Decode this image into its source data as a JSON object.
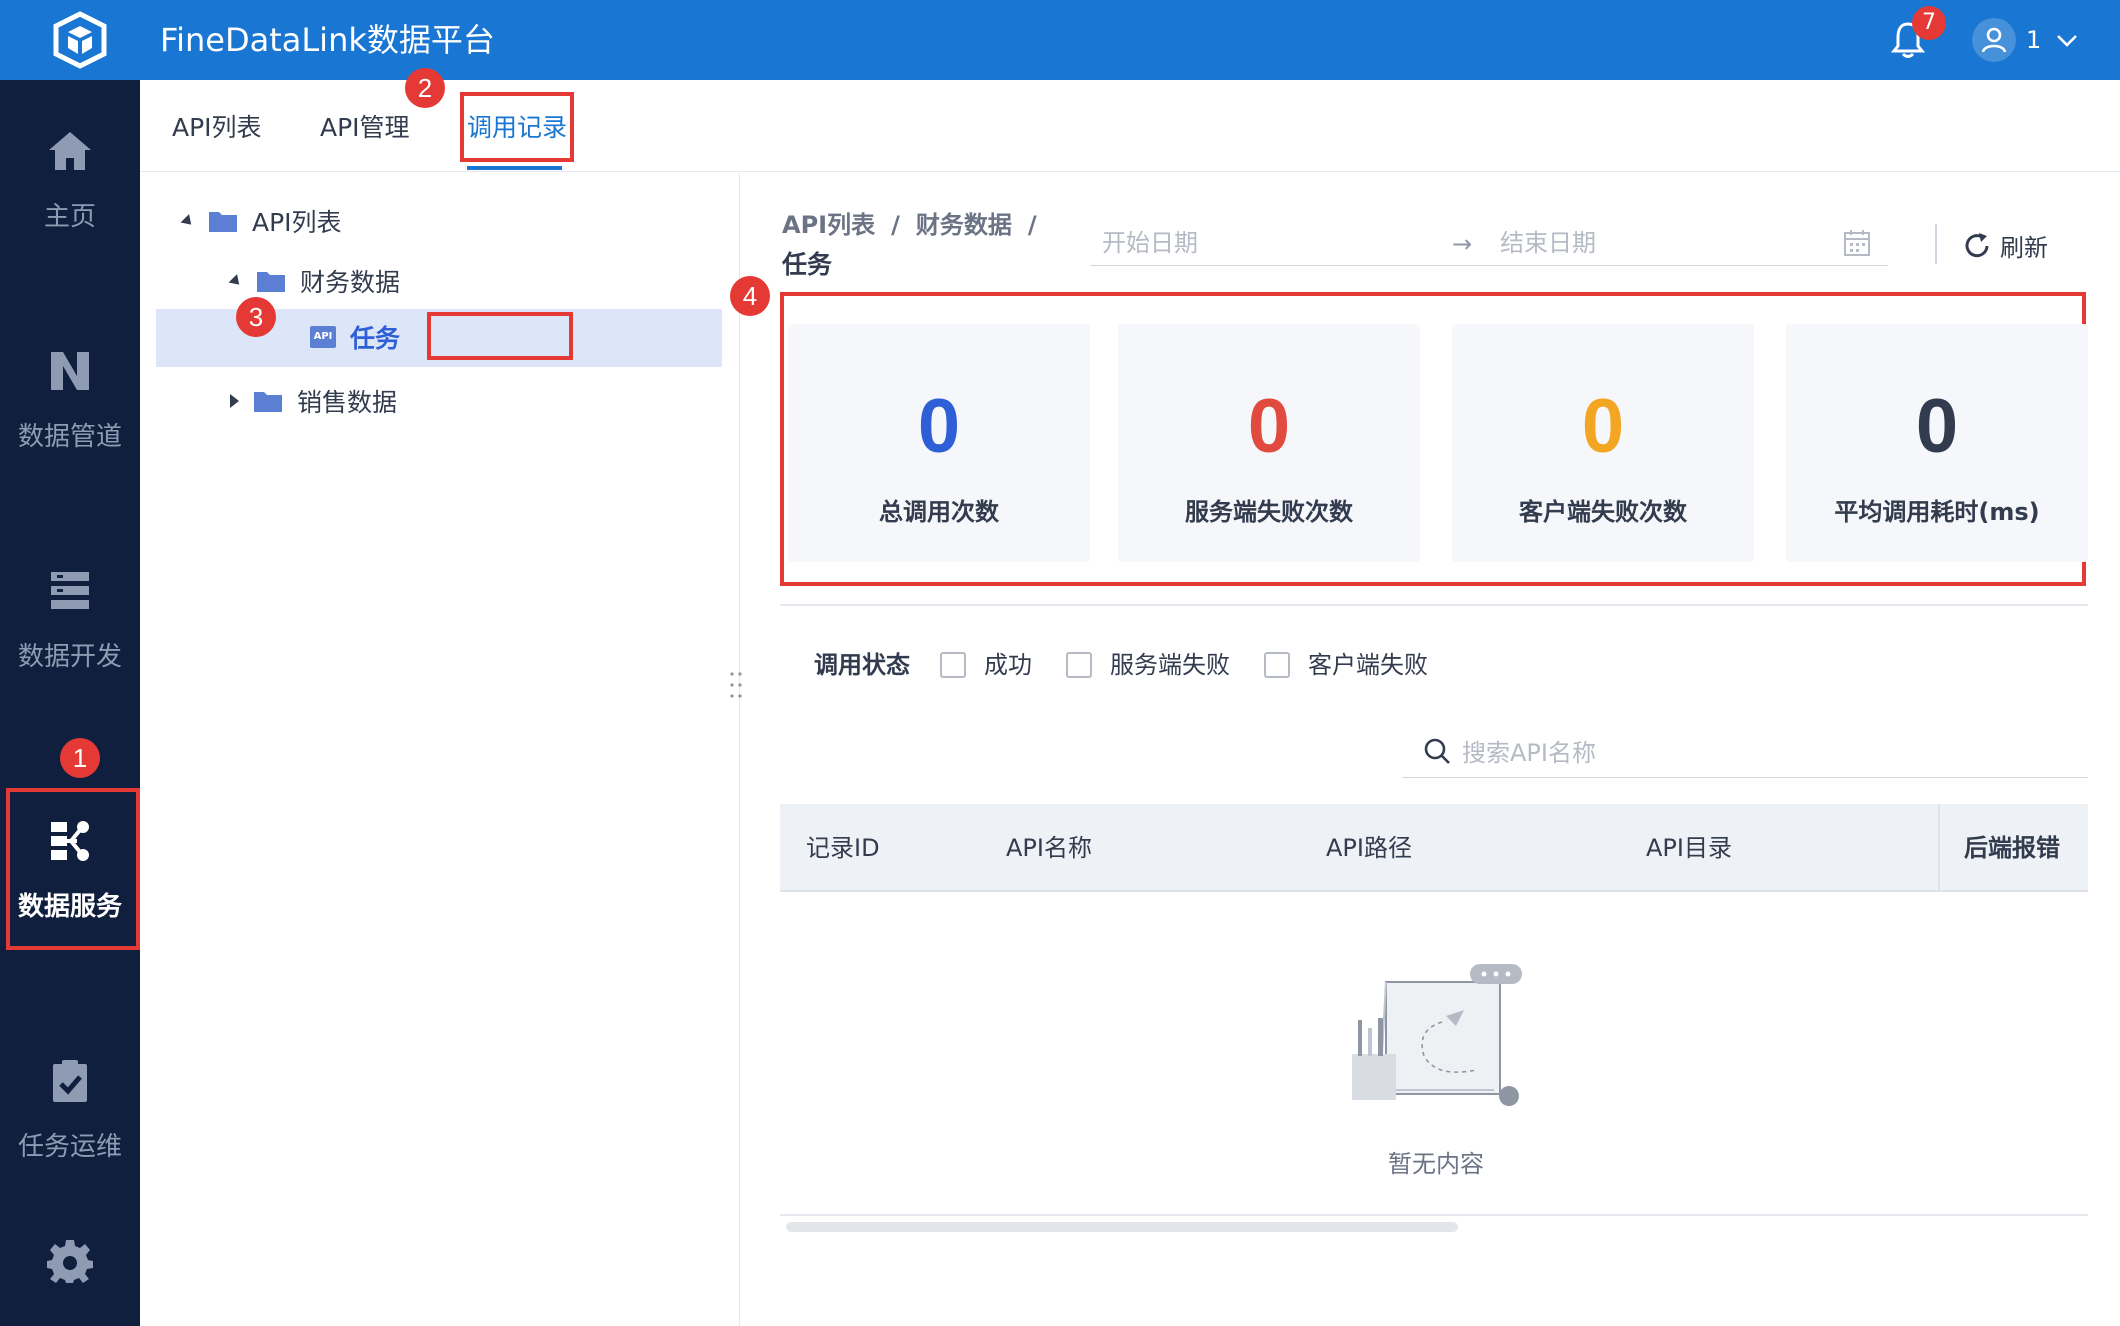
{
  "header": {
    "title": "FineDataLink数据平台",
    "notification_count": "7",
    "user_name": "1"
  },
  "sidebar": {
    "items": [
      {
        "label": "主页",
        "icon": "home-icon"
      },
      {
        "label": "数据管道",
        "icon": "pipeline-icon"
      },
      {
        "label": "数据开发",
        "icon": "dev-icon"
      },
      {
        "label": "数据服务",
        "icon": "data-service-icon",
        "active": true
      },
      {
        "label": "任务运维",
        "icon": "task-ops-icon"
      },
      {
        "label": "",
        "icon": "gear-icon"
      }
    ]
  },
  "tabs": [
    {
      "label": "API列表"
    },
    {
      "label": "API管理"
    },
    {
      "label": "调用记录",
      "active": true
    }
  ],
  "tree": {
    "root": "API列表",
    "children": [
      {
        "label": "财务数据",
        "expanded": true,
        "children": [
          {
            "label": "任务",
            "badge": "API",
            "selected": true
          }
        ]
      },
      {
        "label": "销售数据",
        "expanded": false
      }
    ]
  },
  "main": {
    "breadcrumb": [
      "API列表",
      "财务数据"
    ],
    "breadcrumb_sep": "/",
    "title": "任务",
    "start_date_placeholder": "开始日期",
    "end_date_placeholder": "结束日期",
    "date_arrow": "→",
    "refresh_label": "刷新",
    "stats": [
      {
        "value": "0",
        "label": "总调用次数",
        "color": "#2e5fd6"
      },
      {
        "value": "0",
        "label": "服务端失败次数",
        "color": "#e04a3f"
      },
      {
        "value": "0",
        "label": "客户端失败次数",
        "color": "#f2a622"
      },
      {
        "value": "0",
        "label": "平均调用耗时(ms)",
        "color": "#333c4e"
      }
    ],
    "filter": {
      "label": "调用状态",
      "options": [
        "成功",
        "服务端失败",
        "客户端失败"
      ]
    },
    "search_placeholder": "搜索API名称",
    "table_headers": [
      "记录ID",
      "API名称",
      "API路径",
      "API目录",
      "后端报错"
    ],
    "empty_text": "暂无内容"
  },
  "annotations": [
    "1",
    "2",
    "3",
    "4"
  ],
  "colors": {
    "header_bg": "#1976d2",
    "sidebar_bg": "#0f1f3d",
    "highlight": "#e53935",
    "accent": "#1976d2"
  }
}
